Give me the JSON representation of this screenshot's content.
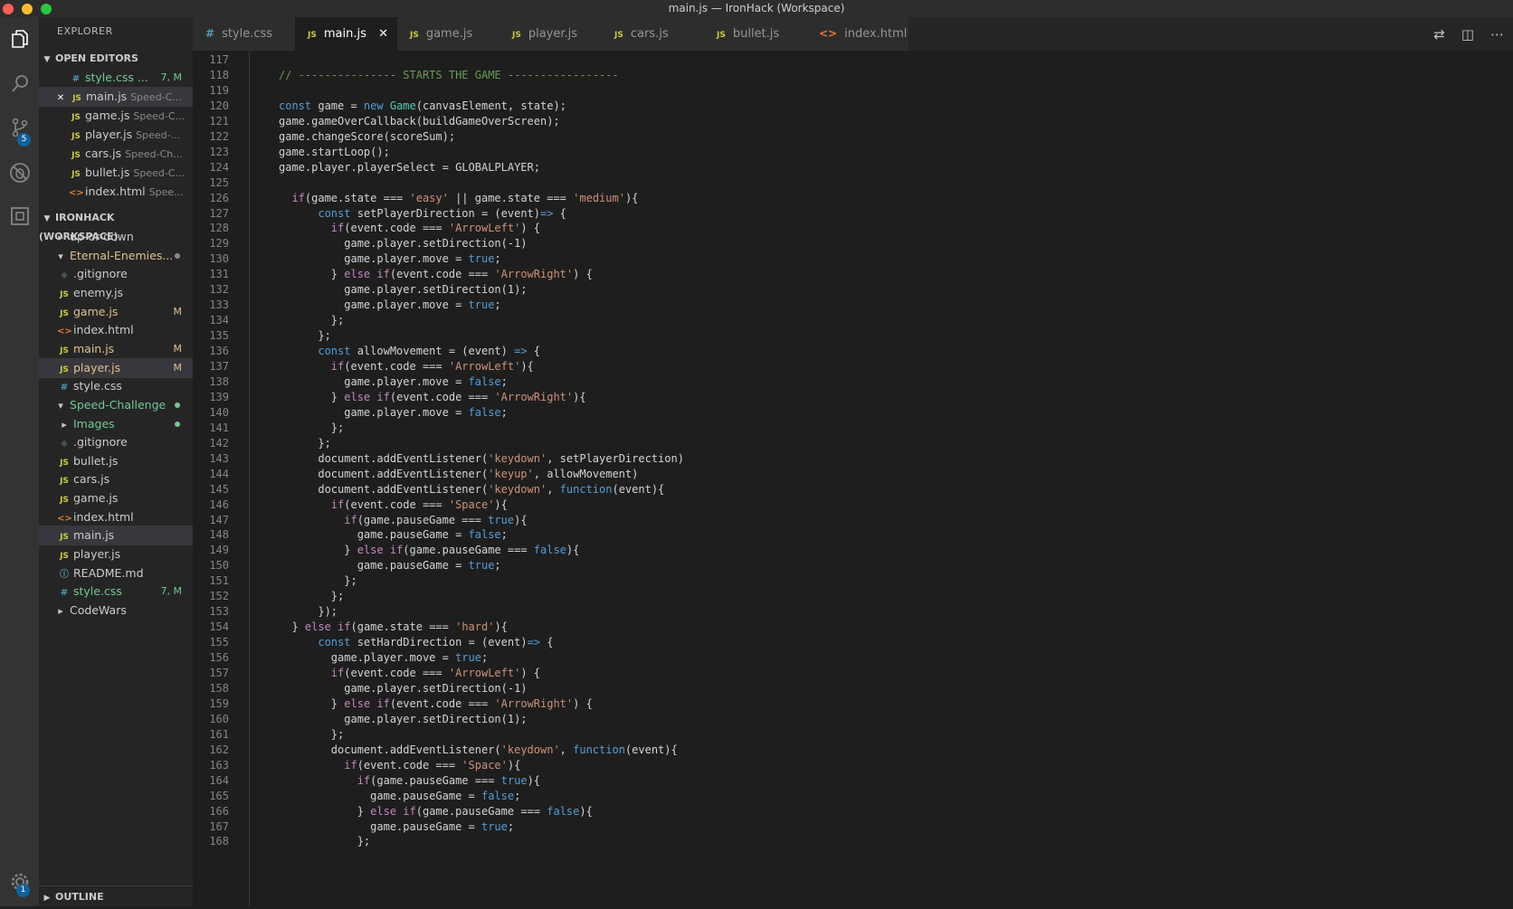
{
  "window": {
    "title": "main.js — IronHack (Workspace)"
  },
  "activity": {
    "scm_badge": "5",
    "settings_badge": "1"
  },
  "sidebar": {
    "title": "EXPLORER",
    "open_editors_label": "OPEN EDITORS",
    "open_editors": [
      {
        "name": "style.css",
        "suffix": "...",
        "desc": "",
        "type": "css",
        "status": "7, M",
        "status_color": "green"
      },
      {
        "name": "main.js",
        "desc": "Speed-C...",
        "type": "js",
        "close": "✕",
        "selected": true
      },
      {
        "name": "game.js",
        "desc": "Speed-C...",
        "type": "js"
      },
      {
        "name": "player.js",
        "desc": "Speed-...",
        "type": "js"
      },
      {
        "name": "cars.js",
        "desc": "Speed-Ch...",
        "type": "js"
      },
      {
        "name": "bullet.js",
        "desc": "Speed-C...",
        "type": "js"
      },
      {
        "name": "index.html",
        "desc": "Spee...",
        "type": "html"
      }
    ],
    "workspace_label": "IRONHACK (WORKSPACE)",
    "tree": [
      {
        "name": "up-or-down",
        "kind": "folder-closed",
        "indent": 1
      },
      {
        "name": "Eternal-Enemies...",
        "kind": "folder-open",
        "indent": 1,
        "color": "mod",
        "dot": "#8a8a8a"
      },
      {
        "name": ".gitignore",
        "type": "git",
        "indent": 2
      },
      {
        "name": "enemy.js",
        "type": "js",
        "indent": 2
      },
      {
        "name": "game.js",
        "type": "js",
        "indent": 2,
        "color": "mod",
        "status": "M"
      },
      {
        "name": "index.html",
        "type": "html",
        "indent": 2
      },
      {
        "name": "main.js",
        "type": "js",
        "indent": 2,
        "color": "mod",
        "status": "M"
      },
      {
        "name": "player.js",
        "type": "js",
        "indent": 2,
        "color": "mod",
        "status": "M",
        "selected": true
      },
      {
        "name": "style.css",
        "type": "css",
        "indent": 2
      },
      {
        "name": "Speed-Challenge",
        "kind": "folder-open",
        "indent": 1,
        "color": "green",
        "dot": "#73c991"
      },
      {
        "name": "Images",
        "kind": "folder-closed",
        "indent": 2,
        "color": "green",
        "dot": "#73c991"
      },
      {
        "name": ".gitignore",
        "type": "git",
        "indent": 2
      },
      {
        "name": "bullet.js",
        "type": "js",
        "indent": 2
      },
      {
        "name": "cars.js",
        "type": "js",
        "indent": 2
      },
      {
        "name": "game.js",
        "type": "js",
        "indent": 2
      },
      {
        "name": "index.html",
        "type": "html",
        "indent": 2
      },
      {
        "name": "main.js",
        "type": "js",
        "indent": 2,
        "selected": true
      },
      {
        "name": "player.js",
        "type": "js",
        "indent": 2
      },
      {
        "name": "README.md",
        "type": "info",
        "indent": 2
      },
      {
        "name": "style.css",
        "type": "css",
        "indent": 2,
        "color": "green",
        "status": "7, M"
      },
      {
        "name": "CodeWars",
        "kind": "folder-closed",
        "indent": 1
      }
    ],
    "outline_label": "OUTLINE"
  },
  "tabs": [
    {
      "label": "style.css",
      "type": "css"
    },
    {
      "label": "main.js",
      "type": "js",
      "active": true,
      "close": "✕"
    },
    {
      "label": "game.js",
      "type": "js"
    },
    {
      "label": "player.js",
      "type": "js"
    },
    {
      "label": "cars.js",
      "type": "js"
    },
    {
      "label": "bullet.js",
      "type": "js"
    },
    {
      "label": "index.html",
      "type": "html"
    }
  ],
  "file_icons": {
    "js": "JS",
    "css": "#",
    "html": "<>",
    "git": "◆",
    "info": "ⓘ"
  },
  "editor": {
    "lines": [
      {
        "n": "117",
        "t": ""
      },
      {
        "n": "118",
        "t": "// --------------- STARTS THE GAME -----------------"
      },
      {
        "n": "119",
        "t": ""
      },
      {
        "n": "120",
        "t": "const game = new Game(canvasElement, state);"
      },
      {
        "n": "121",
        "t": "game.gameOverCallback(buildGameOverScreen);"
      },
      {
        "n": "122",
        "t": "game.changeScore(scoreSum);"
      },
      {
        "n": "123",
        "t": "game.startLoop();"
      },
      {
        "n": "124",
        "t": "game.player.playerSelect = GLOBALPLAYER;"
      },
      {
        "n": "125",
        "t": ""
      },
      {
        "n": "126",
        "t": "  if(game.state === 'easy' || game.state === 'medium'){"
      },
      {
        "n": "127",
        "t": "      const setPlayerDirection = (event)=> {"
      },
      {
        "n": "128",
        "t": "        if(event.code === 'ArrowLeft') {"
      },
      {
        "n": "129",
        "t": "          game.player.setDirection(-1)"
      },
      {
        "n": "130",
        "t": "          game.player.move = true;"
      },
      {
        "n": "131",
        "t": "        } else if(event.code === 'ArrowRight') {"
      },
      {
        "n": "132",
        "t": "          game.player.setDirection(1);"
      },
      {
        "n": "133",
        "t": "          game.player.move = true;"
      },
      {
        "n": "134",
        "t": "        };"
      },
      {
        "n": "135",
        "t": "      };"
      },
      {
        "n": "136",
        "t": "      const allowMovement = (event) => {"
      },
      {
        "n": "137",
        "t": "        if(event.code === 'ArrowLeft'){"
      },
      {
        "n": "138",
        "t": "          game.player.move = false;"
      },
      {
        "n": "139",
        "t": "        } else if(event.code === 'ArrowRight'){"
      },
      {
        "n": "140",
        "t": "          game.player.move = false;"
      },
      {
        "n": "141",
        "t": "        };"
      },
      {
        "n": "142",
        "t": "      };"
      },
      {
        "n": "143",
        "t": "      document.addEventListener('keydown', setPlayerDirection)"
      },
      {
        "n": "144",
        "t": "      document.addEventListener('keyup', allowMovement)"
      },
      {
        "n": "145",
        "t": "      document.addEventListener('keydown', function(event){"
      },
      {
        "n": "146",
        "t": "        if(event.code === 'Space'){"
      },
      {
        "n": "147",
        "t": "          if(game.pauseGame === true){"
      },
      {
        "n": "148",
        "t": "            game.pauseGame = false;"
      },
      {
        "n": "149",
        "t": "          } else if(game.pauseGame === false){"
      },
      {
        "n": "150",
        "t": "            game.pauseGame = true;"
      },
      {
        "n": "151",
        "t": "          };"
      },
      {
        "n": "152",
        "t": "        };"
      },
      {
        "n": "153",
        "t": "      });"
      },
      {
        "n": "154",
        "t": "  } else if(game.state === 'hard'){"
      },
      {
        "n": "155",
        "t": "      const setHardDirection = (event)=> {"
      },
      {
        "n": "156",
        "t": "        game.player.move = true;"
      },
      {
        "n": "157",
        "t": "        if(event.code === 'ArrowLeft') {"
      },
      {
        "n": "158",
        "t": "          game.player.setDirection(-1)"
      },
      {
        "n": "159",
        "t": "        } else if(event.code === 'ArrowRight') {"
      },
      {
        "n": "160",
        "t": "          game.player.setDirection(1);"
      },
      {
        "n": "161",
        "t": "        };"
      },
      {
        "n": "162",
        "t": "        document.addEventListener('keydown', function(event){"
      },
      {
        "n": "163",
        "t": "          if(event.code === 'Space'){"
      },
      {
        "n": "164",
        "t": "            if(game.pauseGame === true){"
      },
      {
        "n": "165",
        "t": "              game.pauseGame = false;"
      },
      {
        "n": "166",
        "t": "            } else if(game.pauseGame === false){"
      },
      {
        "n": "167",
        "t": "              game.pauseGame = true;"
      },
      {
        "n": "168",
        "t": "            };"
      }
    ]
  }
}
